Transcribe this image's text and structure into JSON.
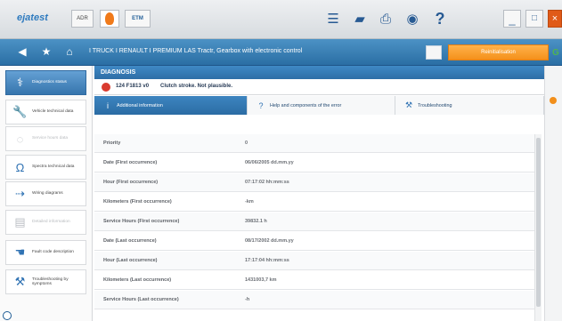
{
  "app": {
    "logo": "ejatest",
    "toolbar_left_labels": {
      "chip_a": "ADR",
      "chip_c": "ETM"
    },
    "window_controls": {
      "minimize": "_",
      "maximize": "□",
      "close": "×"
    },
    "toolbar_icons": [
      "list-icon",
      "book-icon",
      "print-icon",
      "camera-icon",
      "help-icon"
    ]
  },
  "navigation": {
    "breadcrumb": "I TRUCK I RENAULT I PREMIUM LAS Tractr, Gearbox with electronic control",
    "orange_button": "Reinitialisation",
    "end_label": "G"
  },
  "sidebar": {
    "items": [
      {
        "label": "Diagnostics status",
        "icon": "stethoscope-icon",
        "state": "active"
      },
      {
        "label": "Vehicle technical data",
        "icon": "wrench-icon",
        "state": "normal"
      },
      {
        "label": "Service hours data",
        "icon": "disabled-icon",
        "state": "disabled"
      },
      {
        "label": "Spectra technical data",
        "icon": "omega-icon",
        "state": "normal"
      },
      {
        "label": "Wiring diagrams",
        "icon": "wiring-icon",
        "state": "normal"
      },
      {
        "label": "Detailed information",
        "icon": "document-icon",
        "state": "disabled"
      },
      {
        "label": "Fault code description",
        "icon": "hand-pointer-icon",
        "state": "normal"
      },
      {
        "label": "Troubleshooting by symptoms",
        "icon": "tools-icon",
        "state": "normal"
      }
    ]
  },
  "main": {
    "header": "DIAGNOSIS",
    "fault": {
      "code": "124 F1813 v0",
      "description": "Clutch stroke. Not plausible."
    },
    "tabs": [
      {
        "label": "Additional information",
        "icon": "info-icon",
        "active": true
      },
      {
        "label": "Help and components of the error",
        "icon": "question-icon",
        "active": false
      },
      {
        "label": "Troubleshooting",
        "icon": "tools-icon",
        "active": false
      }
    ],
    "table": {
      "rows": [
        {
          "label": "Priority",
          "value": "0"
        },
        {
          "label": "Date (First occurrence)",
          "value": "06/06/2005 dd.mm.yy"
        },
        {
          "label": "Hour (First occurrence)",
          "value": "07:17:02 hh:mm:ss"
        },
        {
          "label": "Kilometers (First occurrence)",
          "value": "-km"
        },
        {
          "label": "Service Hours (First occurrence)",
          "value": "39832.1 h"
        },
        {
          "label": "Date (Last occurrence)",
          "value": "08/17/2002 dd.mm.yy"
        },
        {
          "label": "Hour (Last occurrence)",
          "value": "17:17:04 hh:mm:ss"
        },
        {
          "label": "Kilometers (Last occurrence)",
          "value": "1431003,7 km"
        },
        {
          "label": "Service Hours (Last occurrence)",
          "value": "-h"
        }
      ]
    }
  },
  "colors": {
    "primary": "#2e6ea6",
    "accent": "#f4901b",
    "danger": "#d93b2f"
  }
}
